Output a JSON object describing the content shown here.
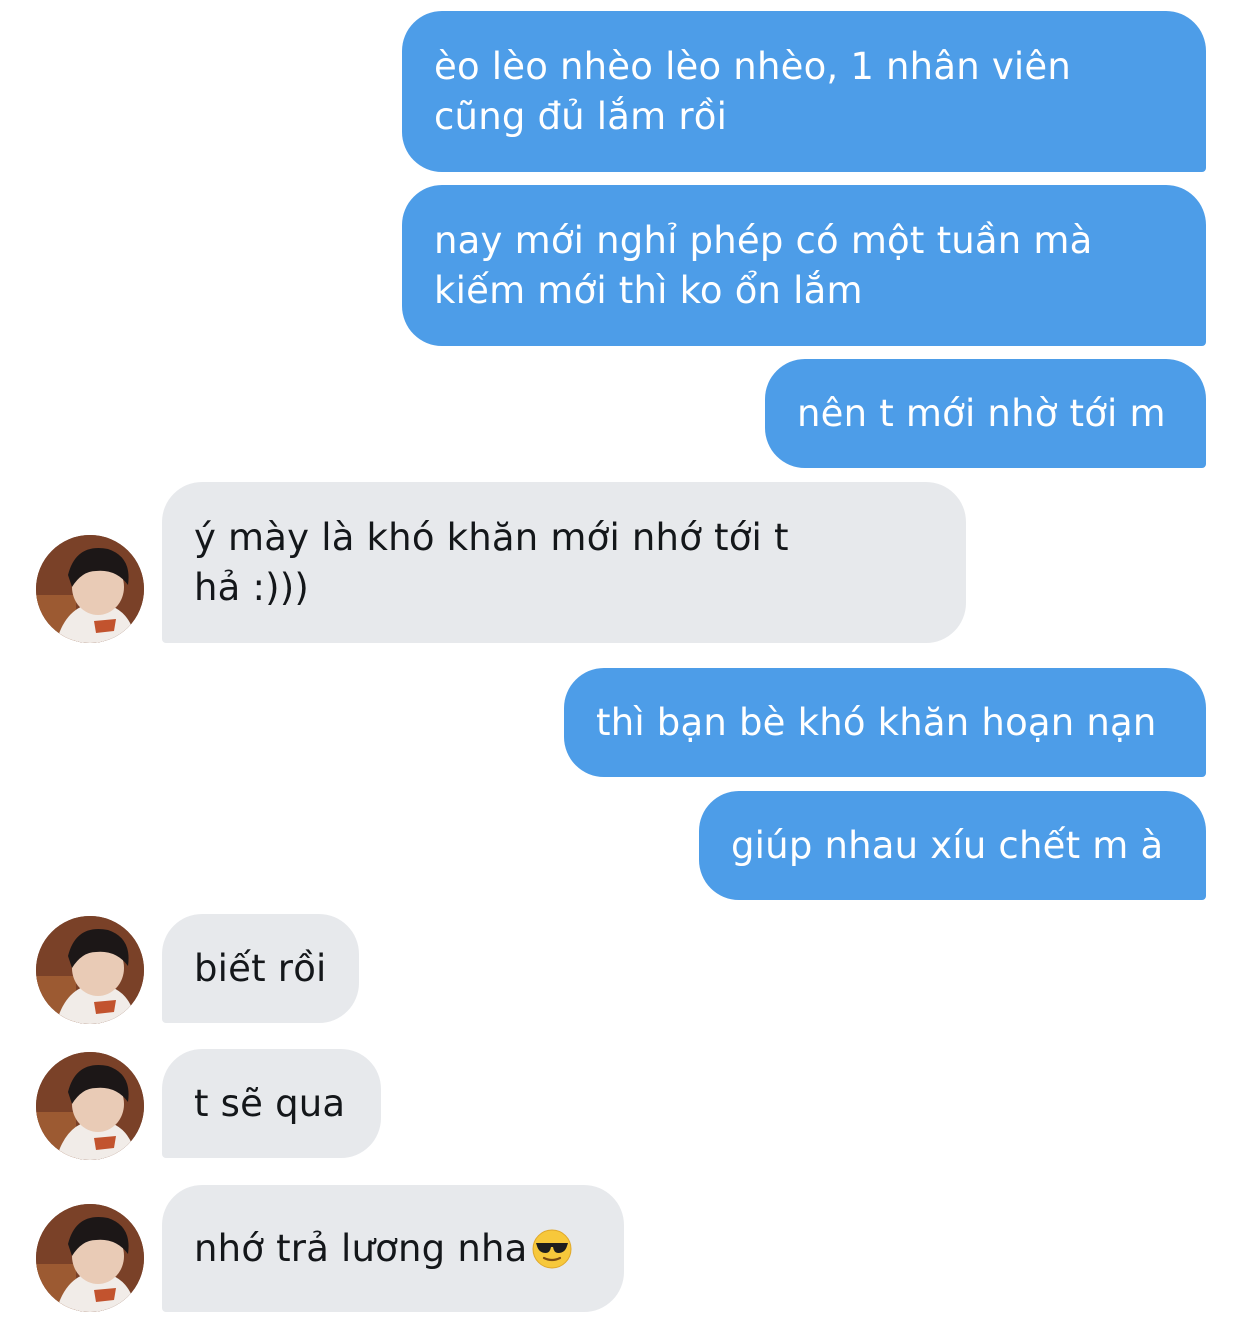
{
  "messages": [
    {
      "side": "out",
      "text": "èo lèo nhèo lèo nhèo, 1 nhân viên\ncũng đủ lắm rồi"
    },
    {
      "side": "out",
      "text": "nay mới nghỉ phép có một tuần mà\nkiếm mới thì ko ổn lắm"
    },
    {
      "side": "out",
      "text": "nên t mới nhờ tới m"
    },
    {
      "side": "in",
      "text": "ý mày là khó khăn mới nhớ tới t\nhả :)))"
    },
    {
      "side": "out",
      "text": "thì bạn bè khó khăn hoạn nạn"
    },
    {
      "side": "out",
      "text": "giúp nhau xíu chết m à"
    },
    {
      "side": "in",
      "text": "biết rồi"
    },
    {
      "side": "in",
      "text": "t sẽ qua"
    },
    {
      "side": "in",
      "text": "nhớ trả lương nha",
      "emoji": "sunglasses-emoji"
    }
  ],
  "colors": {
    "outgoing_bubble": "#4d9de8",
    "incoming_bubble": "#e7e9ec",
    "outgoing_text": "#ffffff",
    "incoming_text": "#14171a"
  }
}
